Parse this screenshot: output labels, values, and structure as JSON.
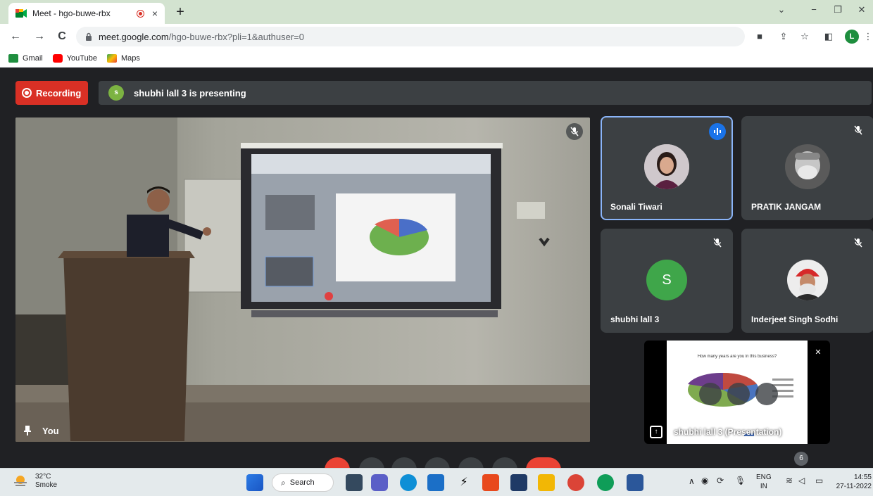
{
  "browser": {
    "tab_title": "Meet - hgo-buwe-rbx",
    "tab_close": "×",
    "new_tab": "+",
    "url_host": "meet.google.com",
    "url_path": "/hgo-buwe-rbx?pli=1&authuser=0",
    "profile_initial": "L",
    "bookmarks": [
      "Gmail",
      "YouTube",
      "Maps"
    ]
  },
  "meet": {
    "recording_label": "Recording",
    "presenter_avatar": "s",
    "presenting_text": "shubhi lall 3 is presenting",
    "self_label": "You",
    "participants": [
      {
        "name": "Sonali Tiwari",
        "speaking": true
      },
      {
        "name": "PRATIK JANGAM",
        "muted": true
      },
      {
        "name": "shubhi lall 3",
        "muted": true,
        "initial": "S"
      },
      {
        "name": "Inderjeet Singh Sodhi",
        "muted": true
      }
    ],
    "presentation_label": "shubhi lall 3 (Presentation)",
    "slide_question": "How many years are you in this business?",
    "people_count": "6"
  },
  "taskbar": {
    "temperature": "32°C",
    "weather": "Smoke",
    "search_label": "Search",
    "lang_top": "ENG",
    "lang_bottom": "IN",
    "time": "14:55",
    "date": "27-11-2022"
  },
  "colors": {
    "recording_red": "#d93025",
    "meet_bg": "#202124",
    "tile_bg": "#3c4043",
    "active_outline": "#8ab4f8",
    "avatar_green": "#3fa64a"
  }
}
